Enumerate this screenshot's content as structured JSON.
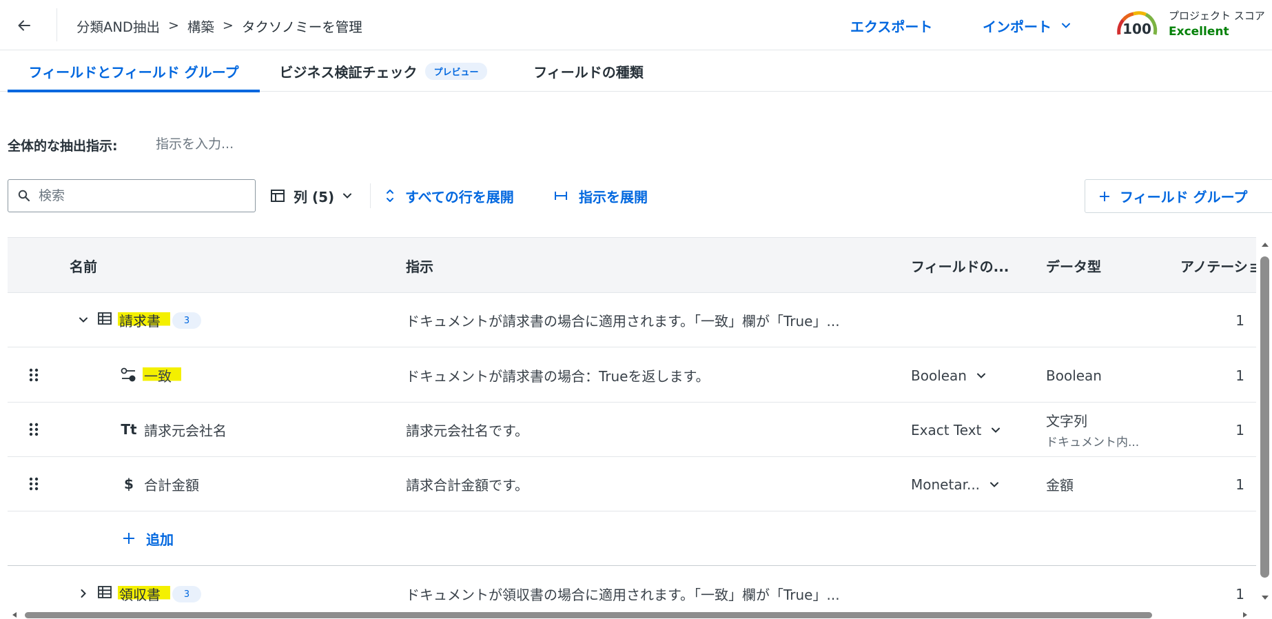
{
  "header": {
    "back_icon": "arrow-left-icon",
    "breadcrumb": [
      "分類AND抽出",
      "構築",
      "タクソノミーを管理"
    ],
    "breadcrumb_separator": ">",
    "export_label": "エクスポート",
    "import_label": "インポート",
    "score": {
      "value": "100",
      "label": "プロジェクト スコア",
      "status": "Excellent",
      "status_color": "#038108",
      "gauge_fraction": 1.0
    }
  },
  "tabs": [
    {
      "label": "フィールドとフィールド グループ",
      "active": true
    },
    {
      "label": "ビジネス検証チェック",
      "badge": "プレビュー",
      "active": false
    },
    {
      "label": "フィールドの種類",
      "active": false
    }
  ],
  "instructions": {
    "label": "全体的な抽出指示:",
    "placeholder": "指示を入力..."
  },
  "toolbar": {
    "search_placeholder": "検索",
    "columns_label": "列 (5)",
    "expand_rows_label": "すべての行を展開",
    "expand_instructions_label": "指示を展開",
    "add_group_label": "フィールド グループ"
  },
  "table": {
    "headers": [
      "名前",
      "指示",
      "フィールドの...",
      "データ型",
      "アノテーション"
    ],
    "rows": [
      {
        "kind": "group",
        "expanded": true,
        "icon": "table-icon",
        "name": "請求書",
        "count": "3",
        "instruction": "ドキュメントが請求書の場合に適用されます。「一致」欄が「True」...",
        "field_type": "",
        "data_type": "",
        "annotations": "1",
        "highlighted": true
      },
      {
        "kind": "field",
        "icon": "toggle-icon",
        "name": "一致",
        "instruction": "ドキュメントが請求書の場合：Trueを返します。",
        "field_type": "Boolean",
        "data_type": "Boolean",
        "annotations": "1",
        "highlighted": true
      },
      {
        "kind": "field",
        "icon": "text-icon",
        "icon_text": "Tt",
        "name": "請求元会社名",
        "instruction": "請求元会社名です。",
        "field_type": "Exact Text",
        "data_type": "文字列",
        "data_type_sub": "ドキュメント内...",
        "annotations": "1"
      },
      {
        "kind": "field",
        "icon": "dollar-icon",
        "icon_text": "$",
        "name": "合計金額",
        "instruction": "請求合計金額です。",
        "field_type": "Monetar...",
        "data_type": "金額",
        "annotations": "1"
      },
      {
        "kind": "add",
        "label": "追加"
      },
      {
        "kind": "group",
        "expanded": false,
        "icon": "table-icon",
        "name": "領収書",
        "count": "3",
        "instruction": "ドキュメントが領収書の場合に適用されます。「一致」欄が「True」...",
        "field_type": "",
        "data_type": "",
        "annotations": "1",
        "highlighted": true
      }
    ]
  },
  "colors": {
    "accent": "#0067df",
    "highlight": "#f4f000",
    "text": "#273139"
  }
}
